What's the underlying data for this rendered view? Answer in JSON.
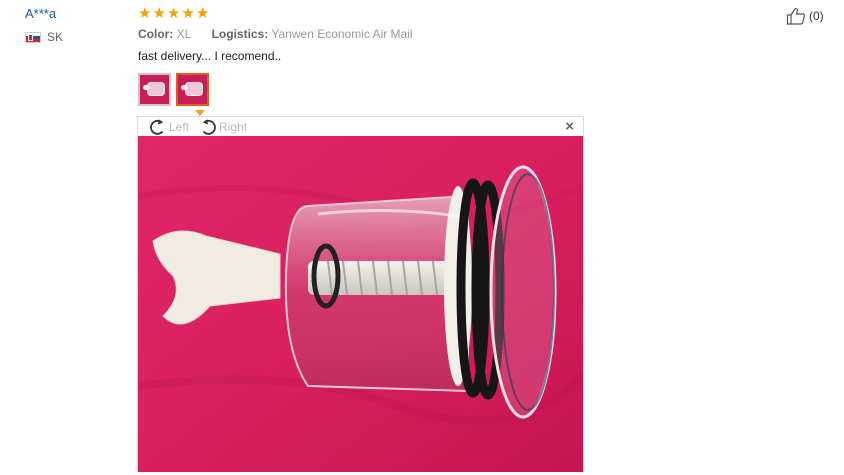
{
  "review": {
    "buyer_name": "A***a",
    "country_code": "SK",
    "rating": 5,
    "attributes": {
      "color_label": "Color:",
      "color_value": "XL",
      "logistics_label": "Logistics:",
      "logistics_value": "Yanwen Economic Air Mail"
    },
    "feedback_text": "fast delivery... I recomend..",
    "helpful_count": "(0)"
  },
  "viewer": {
    "rotate_left_label": "Left",
    "rotate_right_label": "Right",
    "close_symbol": "×"
  },
  "colors": {
    "star": "#f5a200",
    "active_thumb_border": "#e05d1a",
    "photo_background": "#d81e5b",
    "buyer_link": "#1a5aa8"
  },
  "icons": {
    "flag": "slovakia-flag-icon",
    "star": "star-icon",
    "rotate_left": "rotate-left-icon",
    "rotate_right": "rotate-right-icon",
    "close": "close-icon",
    "helpful": "thumbs-up-icon"
  }
}
